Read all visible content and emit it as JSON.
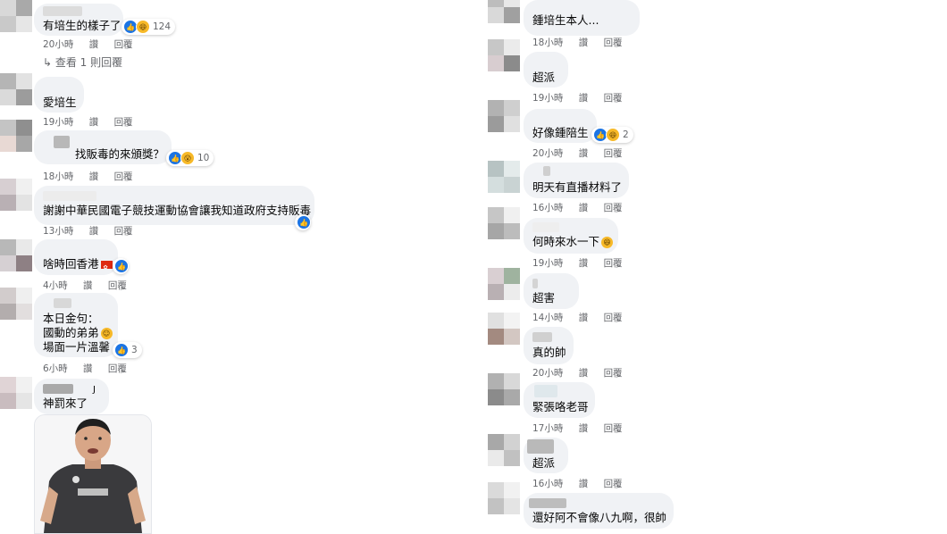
{
  "labels": {
    "like": "讚",
    "reply": "回覆"
  },
  "left_comments": [
    {
      "text": "有培生的樣子了",
      "time": "20小時",
      "reactions": {
        "count": "124"
      }
    },
    {
      "view_replies": "↳ 查看 1 則回覆"
    },
    {
      "text": "愛培生",
      "time": "19小時"
    },
    {
      "text": "找販毒的來頒獎？",
      "time": "18小時",
      "reactions": {
        "count": "10"
      }
    },
    {
      "text": "謝謝中華民國電子競技運動協會讓我知道政府支持販毒",
      "time": "13小時"
    },
    {
      "text": "啥時回香港",
      "time": "4小時"
    },
    {
      "lines": [
        "本日金句：",
        "國動的弟弟",
        "場面一片溫馨"
      ],
      "time": "6小時",
      "reactions": {
        "count": "3"
      }
    },
    {
      "text": "神罰來了",
      "name_fragment": "J"
    }
  ],
  "right_comments": [
    {
      "text": "鍾培生本人...",
      "time": "18小時"
    },
    {
      "text": "超派",
      "time": "19小時"
    },
    {
      "text": "好像鍾陪生",
      "time": "20小時",
      "reactions": {
        "count": "2"
      }
    },
    {
      "text": "明天有直播材料了",
      "time": "16小時"
    },
    {
      "text": "何時來水一下",
      "time": "19小時"
    },
    {
      "text": "超害",
      "time": "14小時"
    },
    {
      "text": "真的帥",
      "time": "20小時"
    },
    {
      "text": "緊張咯老哥",
      "time": "17小時"
    },
    {
      "text": "超派",
      "time": "16小時"
    },
    {
      "text": "還好阿不會像八九啊，很帥"
    }
  ],
  "icons": {
    "like": "thumbs-up-icon",
    "haha": "laughing-face-icon",
    "wow": "surprised-face-icon",
    "flag": "hong-kong-flag-icon",
    "smiley": "smiling-face-icon"
  },
  "colors": {
    "bubble": "#f0f2f5",
    "meta_text": "#65676b",
    "like_blue": "#1b74e4",
    "emoji_yellow": "#f7b928",
    "flag_red": "#de2910"
  }
}
